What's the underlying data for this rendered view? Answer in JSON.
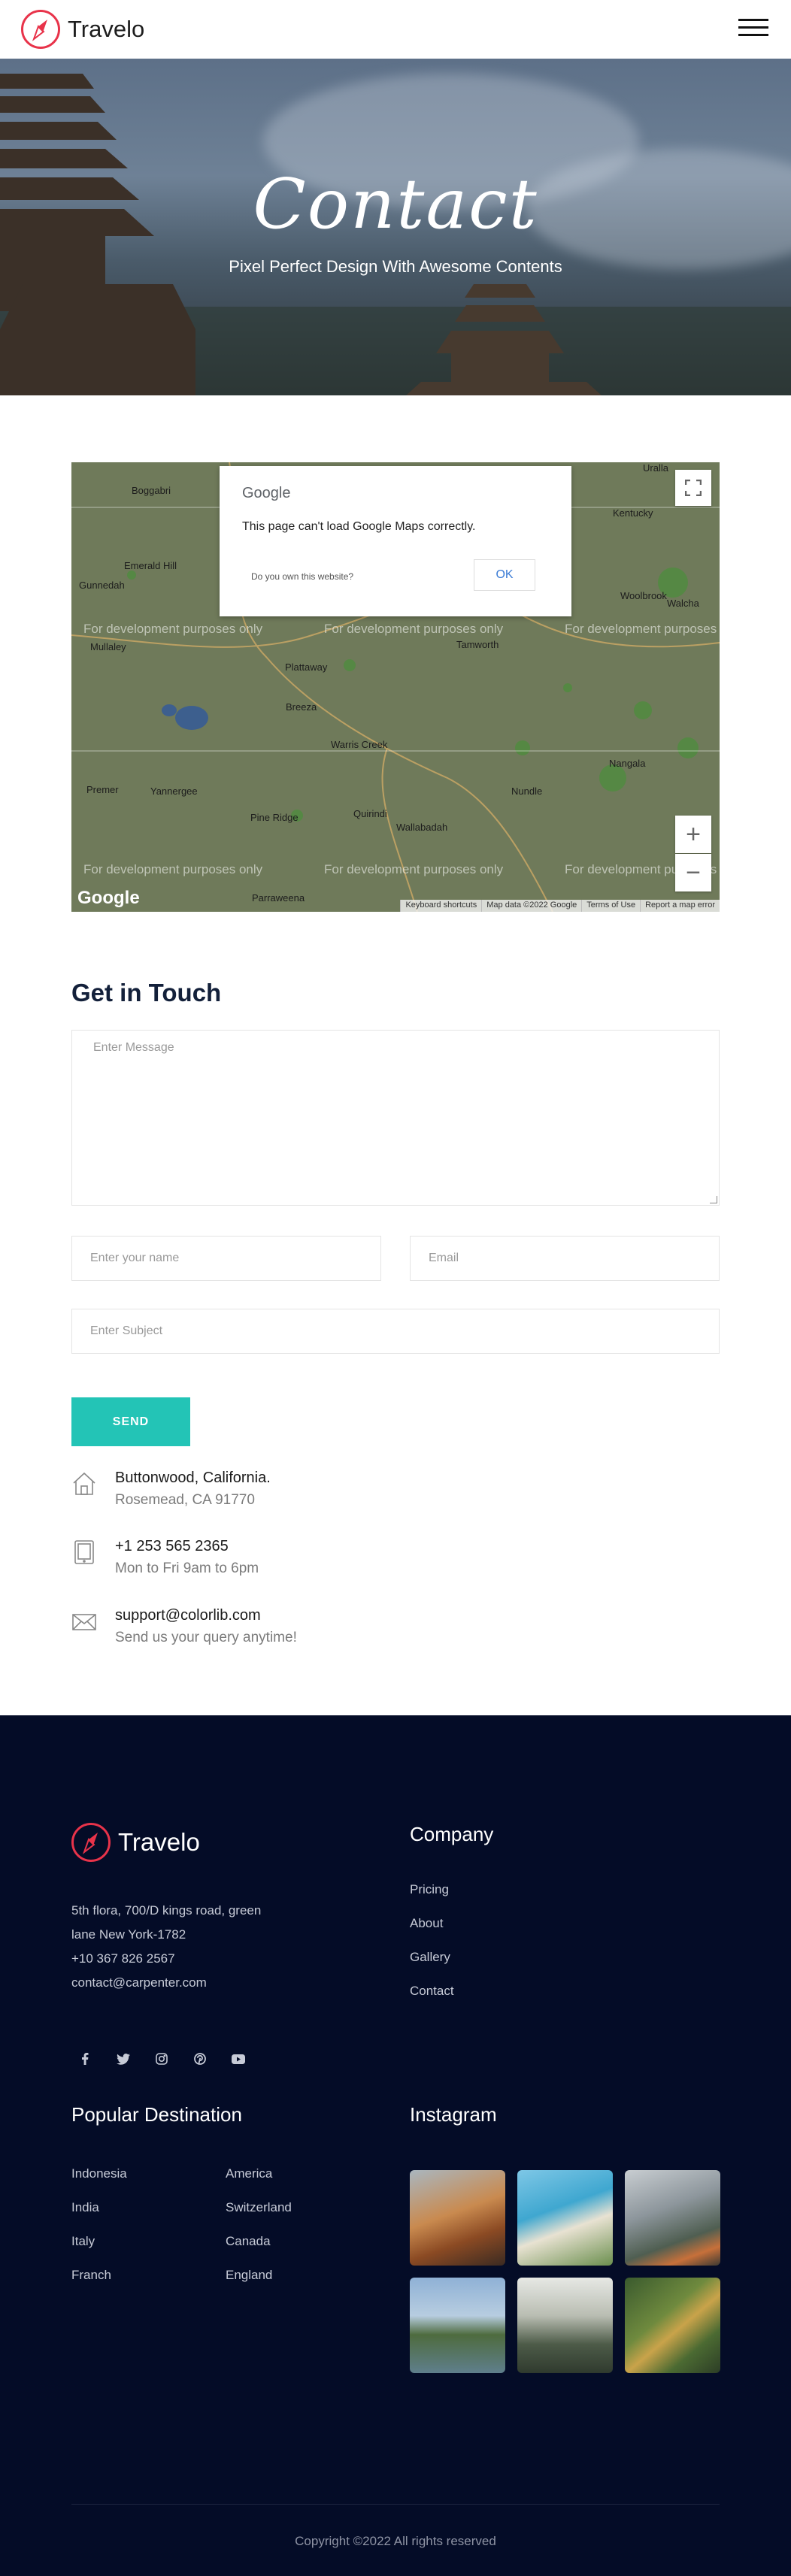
{
  "header": {
    "brand": "Travelo"
  },
  "hero": {
    "title": "Contact",
    "subtitle": "Pixel Perfect Design With Awesome Contents"
  },
  "map": {
    "dialog_brand": "Google",
    "dialog_message": "This page can't load Google Maps correctly.",
    "dialog_question": "Do you own this website?",
    "dialog_ok": "OK",
    "dev_watermark": "For development purposes only",
    "places": [
      "Boggabri",
      "Emerald Hill",
      "Gunnedah",
      "Mullaley",
      "Plattaway",
      "Breeza",
      "Tamworth",
      "Woolbrook",
      "Walcha",
      "Kentucky",
      "Uralla",
      "Warris Creek",
      "Quirindi",
      "Nundle",
      "Nangala",
      "Yannergee",
      "Premer",
      "Pine Ridge",
      "Wallabadah",
      "Parraweena"
    ],
    "footer_links": [
      "Keyboard shortcuts",
      "Map data ©2022 Google",
      "Terms of Use",
      "Report a map error"
    ],
    "google_logo": "Google",
    "zoom_in": "+",
    "zoom_out": "−"
  },
  "contact": {
    "title": "Get in Touch",
    "message_placeholder": "Enter Message",
    "name_placeholder": "Enter your name",
    "email_placeholder": "Email",
    "subject_placeholder": "Enter Subject",
    "send_label": "SEND",
    "info": [
      {
        "icon": "home-icon",
        "title": "Buttonwood, California.",
        "sub": "Rosemead, CA 91770"
      },
      {
        "icon": "tablet-icon",
        "title": "+1 253 565 2365",
        "sub": "Mon to Fri 9am to 6pm"
      },
      {
        "icon": "email-icon",
        "title": "support@colorlib.com",
        "sub": "Send us your query anytime!"
      }
    ]
  },
  "footer": {
    "brand": "Travelo",
    "address_lines": [
      "5th flora, 700/D kings road, green",
      "lane New York-1782",
      "+10 367 826 2567",
      "contact@carpenter.com"
    ],
    "company_heading": "Company",
    "company_links": [
      "Pricing",
      "About",
      "Gallery",
      "Contact"
    ],
    "social_icons": [
      "facebook-icon",
      "twitter-icon",
      "instagram-icon",
      "pinterest-icon",
      "youtube-icon"
    ],
    "destination_heading": "Popular Destination",
    "destinations_col1": [
      "Indonesia",
      "India",
      "Italy",
      "Franch"
    ],
    "destinations_col2": [
      "America",
      "Switzerland",
      "Canada",
      "England"
    ],
    "instagram_heading": "Instagram",
    "copyright": "Copyright ©2022 All rights reserved"
  },
  "colors": {
    "accent": "#23c4b6",
    "brand_red": "#e8334a",
    "footer_bg": "#040c27",
    "heading_dark": "#13203a"
  }
}
